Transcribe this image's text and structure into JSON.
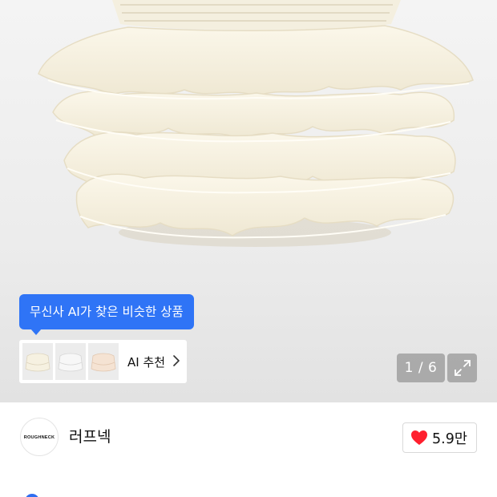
{
  "gallery": {
    "ai_tooltip": "무신사 AI가 찾은 비슷한 상품",
    "ai_recommend_label": "AI 추천",
    "page_indicator": "1 / 6",
    "current_page": 1,
    "total_pages": 6,
    "thumbnails": [
      "ivory-ruffle-skirt",
      "white-ruffle-skirt",
      "beige-ruffle-skirt"
    ]
  },
  "brand": {
    "logo_text": "ROUGHNECK",
    "name": "러프넥"
  },
  "like": {
    "count": "5.9만",
    "icon": "heart-icon",
    "color": "#ff3b45"
  },
  "colors": {
    "accent": "#2f74f6"
  }
}
